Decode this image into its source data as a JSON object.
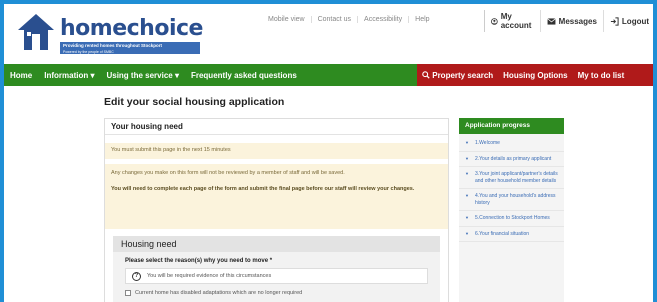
{
  "logo": {
    "name_prefix": "home",
    "name_suffix": "choice",
    "tagline": "Providing rented homes throughout Stockport",
    "tagline_sub": "Powered by the people of SMBC"
  },
  "toplinks": [
    "Mobile view",
    "Contact us",
    "Accessibility",
    "Help"
  ],
  "account": {
    "my_account": "My account",
    "messages": "Messages",
    "logout": "Logout"
  },
  "nav": {
    "left": [
      "Home",
      "Information ▾",
      "Using the service ▾",
      "Frequently asked questions"
    ],
    "property_search": "Property search",
    "housing_options": "Housing Options",
    "todo": "My to do list"
  },
  "page": {
    "title": "Edit your social housing application"
  },
  "form": {
    "card_title": "Your housing need",
    "timer_notice": "You must submit this page in the next 15 minutes",
    "notice_line1": "Any changes you make on this form will not be reviewed by a member of staff and will be saved.",
    "notice_line2": "You will need to complete each page of the form and submit the final page before our staff will review your changes.",
    "section_title": "Housing need",
    "question": "Please select the reason(s) why you need to move *",
    "info": "You will be required evidence of this circumstances",
    "option1": "Current home has disabled adaptations which are no longer required"
  },
  "sidebar": {
    "title": "Application progress",
    "steps": [
      "1.Welcome",
      "2.Your details as primary applicant",
      "3.Your joint applicant/partner's details and other household member details",
      "4.You and your household's address history",
      "5.Connection to Stockport Homes",
      "6.Your financial situation"
    ]
  },
  "colors": {
    "frame": "#1f8fd6",
    "nav_green": "#2e8b20",
    "nav_red": "#b01a1a",
    "notice_bg": "#fbf3dc",
    "brand_blue": "#2a4f8f"
  }
}
